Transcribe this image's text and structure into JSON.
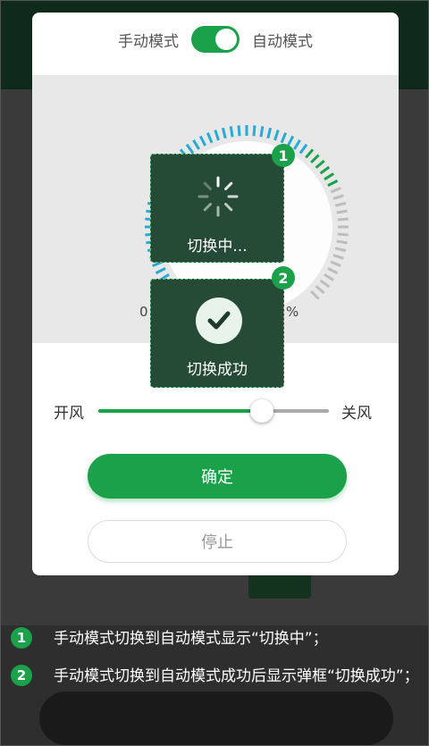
{
  "dialog": {
    "mode_manual": "手动模式",
    "mode_auto": "自动模式",
    "toggle_on": true,
    "gauge": {
      "min_label": "0",
      "max_label": "%"
    },
    "slider": {
      "left_label": "开风",
      "right_label": "关风",
      "value_fraction": 0.71
    },
    "confirm_label": "确定",
    "stop_label": "停止"
  },
  "overlays": [
    {
      "badge": "1",
      "text": "切换中..."
    },
    {
      "badge": "2",
      "text": "切换成功"
    }
  ],
  "notes": [
    {
      "badge": "1",
      "text": "手动模式切换到自动模式显示“切换中”；"
    },
    {
      "badge": "2",
      "text": "手动模式切换到自动模式成功后显示弹框“切换成功”；"
    }
  ],
  "colors": {
    "accent": "#1aa14a",
    "gauge_blue": "#29a9d6",
    "gauge_grey": "#bdbdbd",
    "toast_bg": "#254a35"
  }
}
